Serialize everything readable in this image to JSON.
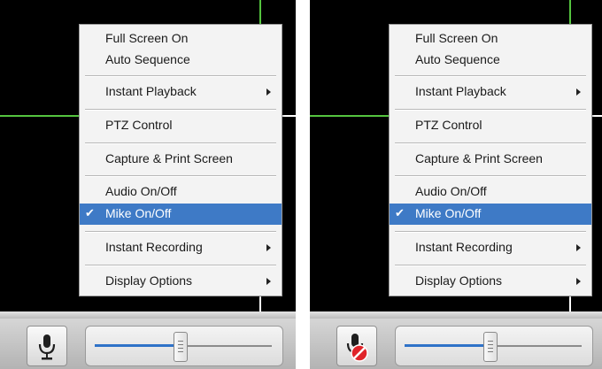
{
  "context_menu": {
    "items": {
      "full_screen": "Full Screen On",
      "auto_sequence": "Auto Sequence",
      "instant_playback": "Instant Playback",
      "ptz_control": "PTZ Control",
      "capture_print": "Capture & Print Screen",
      "audio_toggle": "Audio On/Off",
      "mike_toggle": "Mike On/Off",
      "instant_recording": "Instant Recording",
      "display_options": "Display Options"
    },
    "checked_item": "Mike On/Off",
    "check_glyph": "✔",
    "submenu_items": [
      "Instant Playback",
      "Instant Recording",
      "Display Options"
    ]
  },
  "panels": [
    {
      "state": "mic-enabled",
      "mic_icon": "microphone-icon"
    },
    {
      "state": "mic-muted",
      "mic_icon": "microphone-muted-icon"
    }
  ],
  "volume_slider": {
    "level": 0.48
  },
  "colors": {
    "video_background": "#000000",
    "grid_line": "#55c43f",
    "selection": "#3e7ac6",
    "slider_fill": "#2f72c8",
    "mute_badge": "#e0242a"
  }
}
